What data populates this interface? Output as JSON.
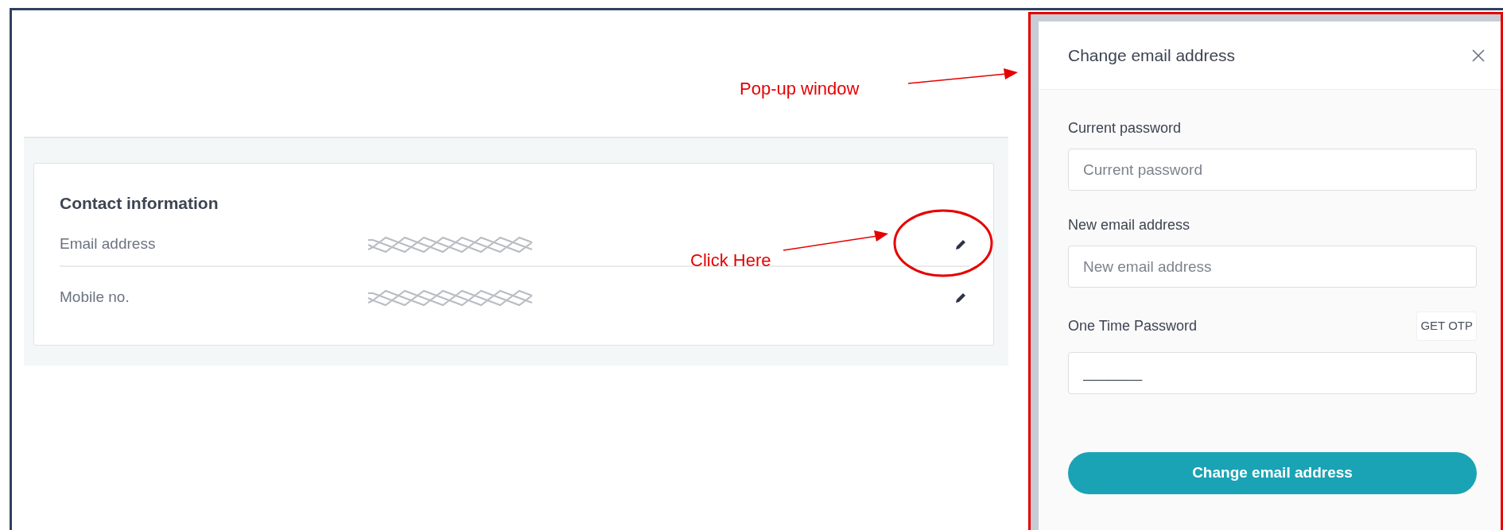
{
  "annotations": {
    "popup_label": "Pop-up window",
    "click_label": "Click Here"
  },
  "contact": {
    "title": "Contact information",
    "rows": [
      {
        "label": "Email address",
        "redacted": true
      },
      {
        "label": "Mobile no.",
        "redacted": true
      }
    ]
  },
  "modal": {
    "title": "Change email address",
    "fields": [
      {
        "label": "Current password",
        "placeholder": "Current password"
      },
      {
        "label": "New email address",
        "placeholder": "New email address"
      },
      {
        "label": "One Time Password",
        "value": "_______",
        "action": "GET OTP"
      }
    ],
    "submit": "Change email address"
  }
}
